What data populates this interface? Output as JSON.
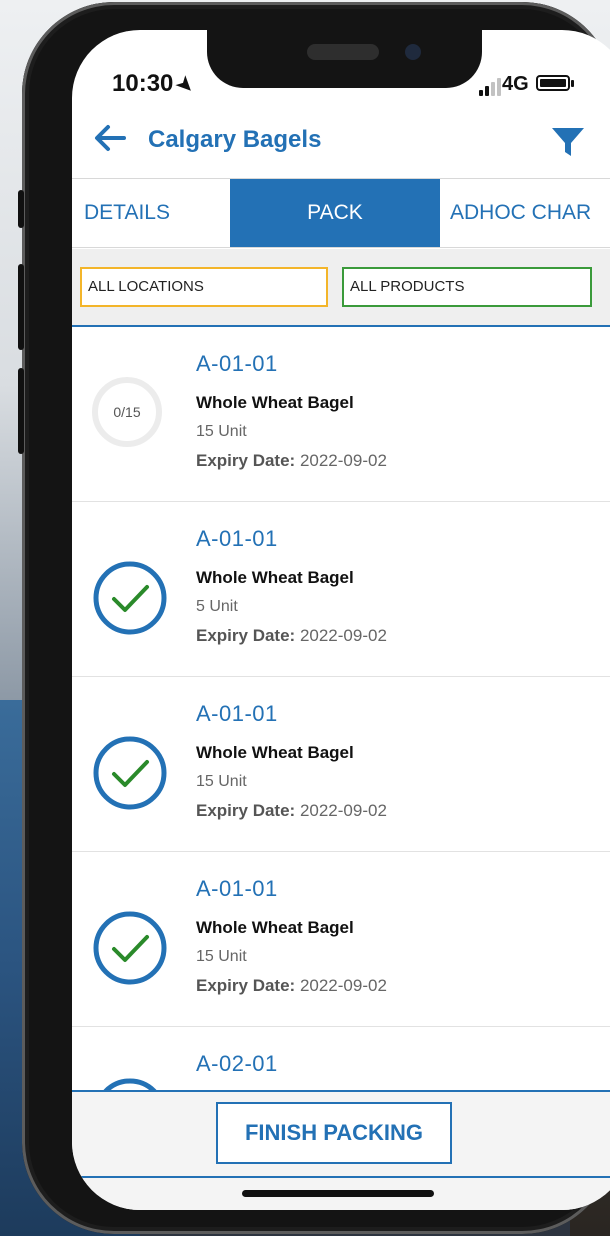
{
  "status_bar": {
    "time": "10:30",
    "network": "4G"
  },
  "header": {
    "title": "Calgary Bagels"
  },
  "tabs": [
    {
      "label": "DETAILS"
    },
    {
      "label": "PACK"
    },
    {
      "label": "ADHOC CHAR"
    }
  ],
  "active_tab": "PACK",
  "filters": {
    "locations": "ALL LOCATIONS",
    "products": "ALL PRODUCTS"
  },
  "colors": {
    "accent": "#2371b5",
    "check": "#2a8a2a",
    "locations_border": "#f3b52a",
    "products_border": "#3a9a3a"
  },
  "items": [
    {
      "location": "A-01-01",
      "product": "Whole Wheat Bagel",
      "quantity": "15 Unit",
      "expiry_label": "Expiry Date:",
      "expiry_value": "2022-09-02",
      "status": "pending",
      "progress": "0/15"
    },
    {
      "location": "A-01-01",
      "product": "Whole Wheat Bagel",
      "quantity": "5 Unit",
      "expiry_label": "Expiry Date:",
      "expiry_value": "2022-09-02",
      "status": "packed"
    },
    {
      "location": "A-01-01",
      "product": "Whole Wheat Bagel",
      "quantity": "15 Unit",
      "expiry_label": "Expiry Date:",
      "expiry_value": "2022-09-02",
      "status": "packed"
    },
    {
      "location": "A-01-01",
      "product": "Whole Wheat Bagel",
      "quantity": "15 Unit",
      "expiry_label": "Expiry Date:",
      "expiry_value": "2022-09-02",
      "status": "packed"
    },
    {
      "location": "A-02-01",
      "status": "packed"
    }
  ],
  "footer": {
    "finish_label": "FINISH PACKING"
  }
}
